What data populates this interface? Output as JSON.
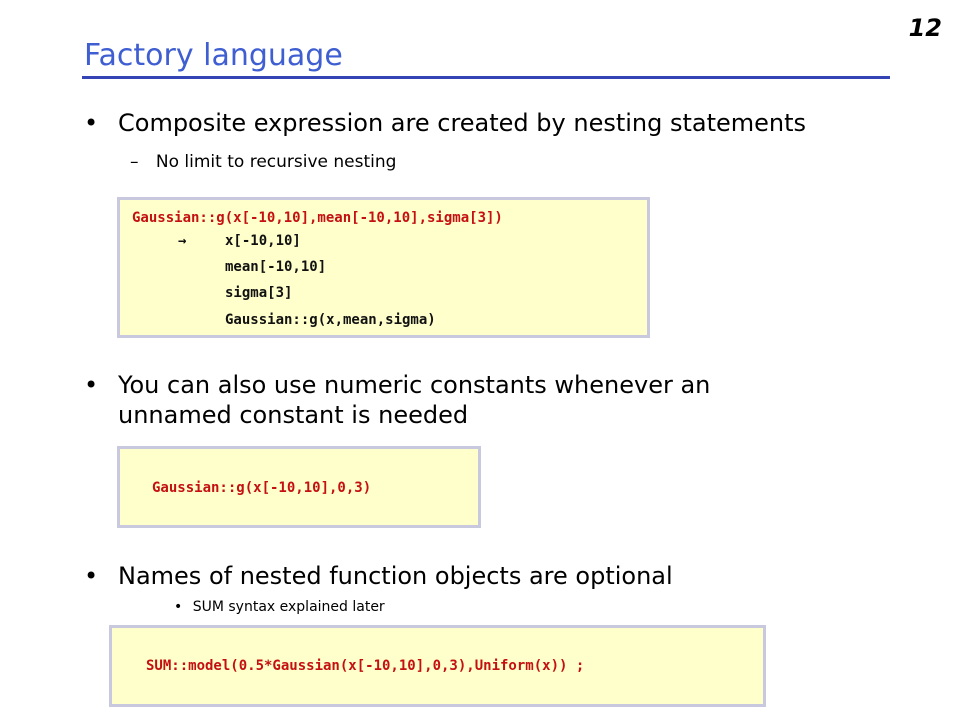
{
  "slide_number": "12",
  "title": "Factory language",
  "bullets": {
    "b1": "Composite expression are created by nesting statements",
    "b1_sub": "No limit to recursive nesting",
    "b2_line1": "You can also use numeric constants whenever an",
    "b2_line2": "unnamed constant is needed",
    "b3": "Names of nested function objects are optional",
    "b3_sub": "SUM syntax explained later"
  },
  "code1": {
    "line1": "Gaussian::g(x[-10,10],mean[-10,10],sigma[3])",
    "arrow": "→",
    "line2": "x[-10,10]",
    "line3": "mean[-10,10]",
    "line4": "sigma[3]",
    "line5": "Gaussian::g(x,mean,sigma)"
  },
  "code2": {
    "line1": "Gaussian::g(x[-10,10],0,3)"
  },
  "code3": {
    "line1": "SUM::model(0.5*Gaussian(x[-10,10],0,3),Uniform(x)) ;"
  },
  "colors": {
    "title": "#3e5ed1",
    "rule": "#3444b4",
    "code_red": "#c41010",
    "code_bg": "#ffffcc",
    "code_border": "#c8c8de"
  }
}
